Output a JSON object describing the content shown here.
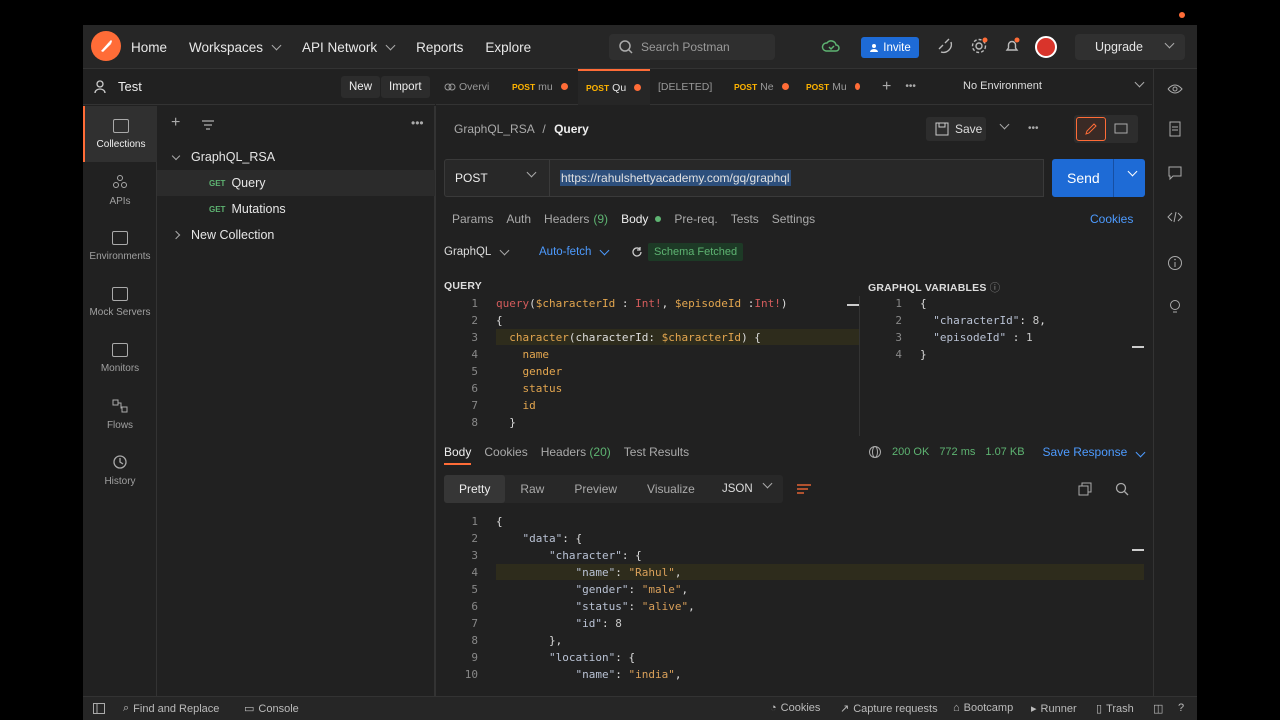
{
  "nav": {
    "home": "Home",
    "workspaces": "Workspaces",
    "api_network": "API Network",
    "reports": "Reports",
    "explore": "Explore",
    "search_placeholder": "Search Postman",
    "invite": "Invite",
    "upgrade": "Upgrade"
  },
  "workspace": {
    "name": "Test",
    "new_label": "New",
    "import_label": "Import"
  },
  "rail": [
    {
      "label": "Collections",
      "icon": "collections-icon"
    },
    {
      "label": "APIs",
      "icon": "apis-icon"
    },
    {
      "label": "Environments",
      "icon": "environments-icon"
    },
    {
      "label": "Mock Servers",
      "icon": "mock-servers-icon"
    },
    {
      "label": "Monitors",
      "icon": "monitors-icon"
    },
    {
      "label": "Flows",
      "icon": "flows-icon"
    },
    {
      "label": "History",
      "icon": "history-icon"
    }
  ],
  "tree": {
    "collection": "GraphQL_RSA",
    "items": [
      {
        "method": "GET",
        "name": "Query"
      },
      {
        "method": "GET",
        "name": "Mutations"
      }
    ],
    "new_collection": "New Collection"
  },
  "tabs": [
    {
      "method": "",
      "label": "Overvi",
      "dot": false
    },
    {
      "method": "POST",
      "label": "mu",
      "dot": true
    },
    {
      "method": "POST",
      "label": "Qu",
      "dot": true
    },
    {
      "method": "",
      "label": "[DELETED]",
      "dot": false
    },
    {
      "method": "POST",
      "label": "Ne",
      "dot": true
    },
    {
      "method": "POST",
      "label": "Mu",
      "dot": true
    }
  ],
  "environment": "No Environment",
  "breadcrumb": {
    "parent": "GraphQL_RSA",
    "sep": "/",
    "current": "Query"
  },
  "save_label": "Save",
  "request": {
    "method": "POST",
    "url": "https://rahulshettyacademy.com/gq/graphql",
    "send": "Send"
  },
  "req_tabs": {
    "params": "Params",
    "auth": "Auth",
    "headers": "Headers",
    "headers_count": "(9)",
    "body": "Body",
    "prereq": "Pre-req.",
    "tests": "Tests",
    "settings": "Settings",
    "cookies": "Cookies"
  },
  "body_opts": {
    "mode": "GraphQL",
    "autofetch": "Auto-fetch",
    "schema": "Schema Fetched"
  },
  "query_label": "QUERY",
  "vars_label": "GRAPHQL VARIABLES",
  "response": {
    "tabs": {
      "body": "Body",
      "cookies": "Cookies",
      "headers": "Headers",
      "headers_count": "(20)",
      "tests": "Test Results"
    },
    "status": "200 OK",
    "time": "772 ms",
    "size": "1.07 KB",
    "save": "Save Response",
    "views": [
      "Pretty",
      "Raw",
      "Preview",
      "Visualize"
    ],
    "format": "JSON"
  },
  "footer": {
    "find_replace": "Find and Replace",
    "console": "Console",
    "cookies": "Cookies",
    "capture": "Capture requests",
    "bootcamp": "Bootcamp",
    "runner": "Runner",
    "trash": "Trash"
  },
  "colors": {
    "accent": "#ff6c37",
    "primary": "#1e6bd6",
    "success": "#5eb472"
  }
}
